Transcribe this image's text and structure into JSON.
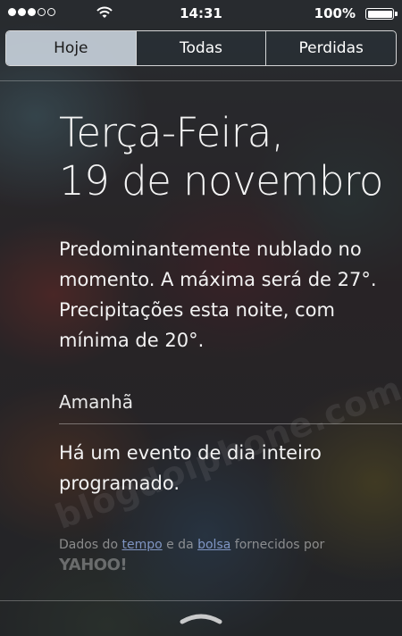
{
  "status_bar": {
    "time": "14:31",
    "battery": "100%",
    "signal_dots_filled": 3,
    "signal_dots_total": 5,
    "wifi_icon": "wifi-icon"
  },
  "tabs": [
    {
      "label": "Hoje",
      "selected": true
    },
    {
      "label": "Todas",
      "selected": false
    },
    {
      "label": "Perdidas",
      "selected": false
    }
  ],
  "today": {
    "weekday": "Terça-Feira,",
    "date": "19 de novembro",
    "weather_summary": "Predominantemente nublado no momento. A máxima será de 27°. Precipitações esta noite, com mínima de 20°."
  },
  "tomorrow": {
    "label": "Amanhã",
    "summary": "Há um evento de dia inteiro programado."
  },
  "credits": {
    "prefix": "Dados do ",
    "weather_link": "tempo",
    "middle": " e da ",
    "stocks_link": "bolsa",
    "suffix": " fornecidos por",
    "provider": "YAHOO!"
  },
  "watermark": "blogdoiphone.com",
  "handle_icon": "chevron-up-handle-icon"
}
